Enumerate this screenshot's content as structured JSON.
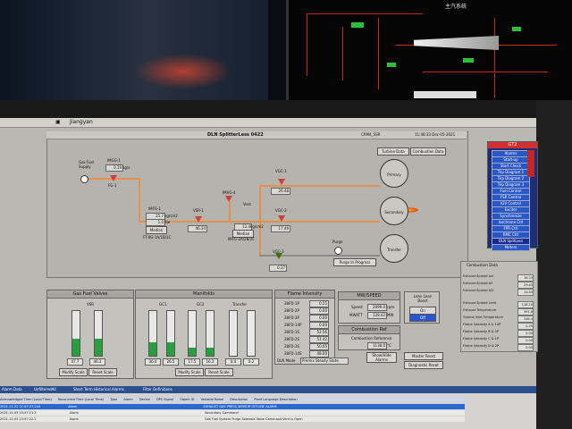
{
  "window": {
    "title": "Jiangyan",
    "diagram_title": "DLN SplitterLess 0422",
    "crm": "CRM4_SSR",
    "datetime": "11:48:33 Dec-05-2021"
  },
  "schematic": {
    "label": "主汽系统"
  },
  "header_buttons": [
    "Turbine Data",
    "Combustion Data"
  ],
  "diagram": {
    "gas_fuel_supply": "Gas Fuel\nSupply",
    "srv_label": "IMGG-1",
    "srv_value": "0.19",
    "srv_unit": "kg/s",
    "fg1": "FG-1",
    "imfg_label": "IMFG-1",
    "imfg_values": [
      "25.7",
      "1.0"
    ],
    "imfg_units": [
      "kg/cm2",
      "Bar"
    ],
    "median_button": "Median",
    "ft_label": "FT-0G-1A/1B/1C",
    "vsr1_label": "VSR-1",
    "vsr1_value": "46.34",
    "imvg_label": "IMVG-4",
    "imvg_value": "13.4",
    "imvg_unit": "kg/cm2",
    "vent_label": "Vent",
    "median2_button": "Median",
    "imfg2_label": "IMFG-2A/2B/2C",
    "vgc1_label": "VGC-1",
    "vgc1_value": "26.48",
    "vgc2_label": "VGC-2",
    "vgc2_value": "17.49",
    "vgc3_label": "VGC-3",
    "vgc3_value": "0.37",
    "primary_label": "Primary",
    "secondary_label": "Secondary",
    "transfer_label": "Transfer",
    "purge_label": "Purge",
    "purge_status": "Purge In Progress"
  },
  "gas_fuel_valves": {
    "title": "Gas Fuel Valves",
    "vsr_label": "VSR",
    "bars": [
      {
        "fill": 0.38,
        "value": "47.7"
      },
      {
        "fill": 0.38,
        "value": "46.3"
      }
    ],
    "buttons": [
      "Modify Scale",
      "Reset Scale"
    ],
    "axis_top": "%"
  },
  "manifolds": {
    "title": "Manifolds",
    "labels": [
      "GC1",
      "GC2",
      "Transfer"
    ],
    "bars": [
      {
        "fill": 0.3,
        "value": "36.0"
      },
      {
        "fill": 0.3,
        "value": "26.5"
      },
      {
        "fill": 0.18,
        "value": "17.5"
      },
      {
        "fill": 0.18,
        "value": "16.3"
      },
      {
        "fill": 0.0,
        "value": "0.4"
      },
      {
        "fill": 0.0,
        "value": "0.2"
      }
    ],
    "buttons": [
      "Modify Scale",
      "Reset Scale"
    ]
  },
  "flame_intensity": {
    "title": "Flame Intensity",
    "rows": [
      {
        "label": "28FD-1P",
        "value": "0.25"
      },
      {
        "label": "28FD-2P",
        "value": "0.00"
      },
      {
        "label": "28FD-3P",
        "value": "0.00"
      },
      {
        "label": "28FD-14P",
        "value": "0.00"
      },
      {
        "label": "28FD-1S",
        "value": "52.56"
      },
      {
        "label": "28FD-2S",
        "value": "51.42"
      },
      {
        "label": "28FD-3S",
        "value": "50.05"
      },
      {
        "label": "28FD-14S",
        "value": "48.00"
      }
    ],
    "mode_label": "DLN Mode",
    "mode_value": "Premix Steady State"
  },
  "mw_speed": {
    "title": "MW/SPEED",
    "speed_label": "Speed",
    "speed_value": "2999.0",
    "speed_unit": "rpm",
    "mw_label": "MWATT",
    "mw_value": "128.02",
    "mw_unit": "MW"
  },
  "lean_boost": {
    "title": "Lean Lean Boost",
    "on": "On",
    "off": "Off"
  },
  "combustion": {
    "ref_title": "Combustion Ref",
    "reference_label": "Combustion Reference",
    "reference_value": "1138.0",
    "reference_unit": "°C"
  },
  "bottom_buttons": [
    "Show/Hide Alarms",
    "Master Reset",
    "Diagnostic Reset"
  ],
  "menu": {
    "title": "GT2",
    "items": [
      "Alarms",
      "Start-up",
      "Start Check",
      "Trip Diagram 1",
      "Trip Diagram 2",
      "Trip Diagram 3",
      "Fuel Control",
      "FSR Control",
      "IGV Control",
      "Exciter",
      "Synchronize",
      "Isochrone Ctrl",
      "FPR Ctrl",
      "RMC Ctrl",
      "DLN SplitLess",
      "Meters"
    ],
    "selected_index": 14
  },
  "combustion_data": {
    "title": "Combustion Data",
    "rows": [
      {
        "label": "Exhaust Spread Act",
        "value": "16.23"
      },
      {
        "label": "Exhaust Spread All",
        "value": "29.63"
      },
      {
        "label": "Exhaust Spread Al2",
        "value": "14.83"
      },
      {
        "label": "Exhaust Spread Limit",
        "value": "118.10"
      },
      {
        "label": "Exhaust Temperature",
        "value": "591.8"
      },
      {
        "label": "Turbine Inlet Temperature",
        "value": "348.4"
      },
      {
        "label": "Flame Intensity A & 14P",
        "value": "0.25"
      },
      {
        "label": "Flame Intensity B & 3P",
        "value": "0.00"
      },
      {
        "label": "Flame Intensity C & 1P",
        "value": "0.00"
      },
      {
        "label": "Flame Intensity D & 2P",
        "value": "0.00"
      }
    ]
  },
  "taskbar": {
    "tabs": [
      "Alarm Data",
      "UnfilteredAll",
      "Short Term Historical Alarms",
      "Filter Definitions"
    ],
    "columns": [
      "Acknowledged Time (Local Time)",
      "Reconciled Time (Local Time)",
      "Type",
      "Alarm",
      "Device",
      "DPC Signal",
      "Object ID",
      "Variable Name",
      "Description",
      "Plant Language Description"
    ],
    "rows": [
      {
        "time": "2021-11-22 21:07:07.244",
        "type": "Alarm",
        "desc": "EXHAUST GAS PRESS SENSOR OFFLINE ALARM"
      },
      {
        "time": "2021-12-03 13:57:21.3",
        "type": "Alarm",
        "desc": "Secondary Command"
      },
      {
        "time": "2021-12-03 13:57:22.2",
        "type": "Alarm",
        "desc": "Gas Fuel System Purge Solenoid Valve Command Vent Is Open"
      }
    ]
  }
}
